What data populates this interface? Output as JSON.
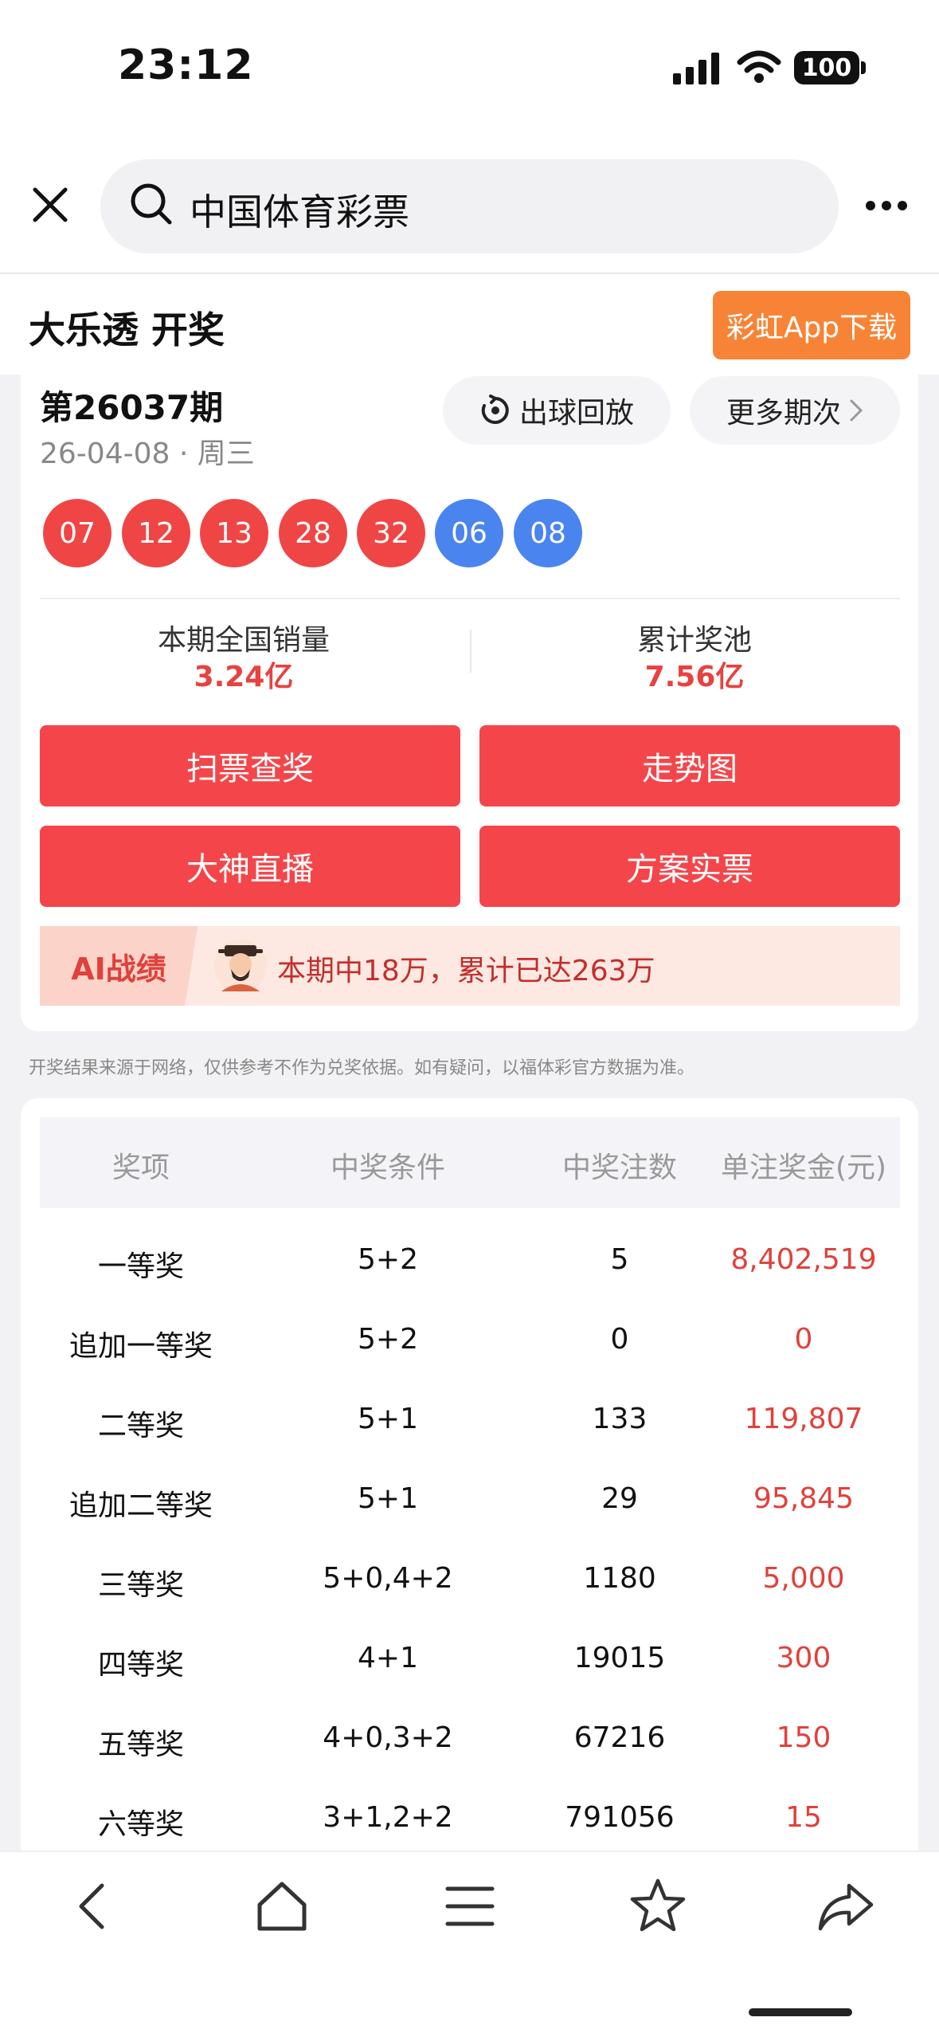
{
  "status_bar": {
    "time": "23:12",
    "battery": "100"
  },
  "search": {
    "query": "中国体育彩票"
  },
  "header": {
    "title": "大乐透 开奖",
    "download_button": "彩虹App下载"
  },
  "draw": {
    "issue": "第26037期",
    "date": "26-04-08 · 周三",
    "replay_button": "出球回放",
    "more_issues_button": "更多期次",
    "red_balls": [
      "07",
      "12",
      "13",
      "28",
      "32"
    ],
    "blue_balls": [
      "06",
      "08"
    ],
    "sales_label": "本期全国销量",
    "sales_value": "3.24亿",
    "pool_label": "累计奖池",
    "pool_value": "7.56亿"
  },
  "actions": [
    "扫票查奖",
    "走势图",
    "大神直播",
    "方案实票"
  ],
  "ai": {
    "tag": "AI战绩",
    "text": "本期中18万，累计已达263万"
  },
  "disclaimer": "开奖结果来源于网络，仅供参考不作为兑奖依据。如有疑问，以福体彩官方数据为准。",
  "prize_table": {
    "headers": [
      "奖项",
      "中奖条件",
      "中奖注数",
      "单注奖金(元)"
    ],
    "rows": [
      [
        "一等奖",
        "5+2",
        "5",
        "8,402,519"
      ],
      [
        "追加一等奖",
        "5+2",
        "0",
        "0"
      ],
      [
        "二等奖",
        "5+1",
        "133",
        "119,807"
      ],
      [
        "追加二等奖",
        "5+1",
        "29",
        "95,845"
      ],
      [
        "三等奖",
        "5+0,4+2",
        "1180",
        "5,000"
      ],
      [
        "四等奖",
        "4+1",
        "19015",
        "300"
      ],
      [
        "五等奖",
        "4+0,3+2",
        "67216",
        "150"
      ],
      [
        "六等奖",
        "3+1,2+2",
        "791056",
        "15"
      ]
    ]
  },
  "bottom_nav": [
    "back-icon",
    "home-icon",
    "menu-icon",
    "star-icon",
    "share-icon"
  ]
}
